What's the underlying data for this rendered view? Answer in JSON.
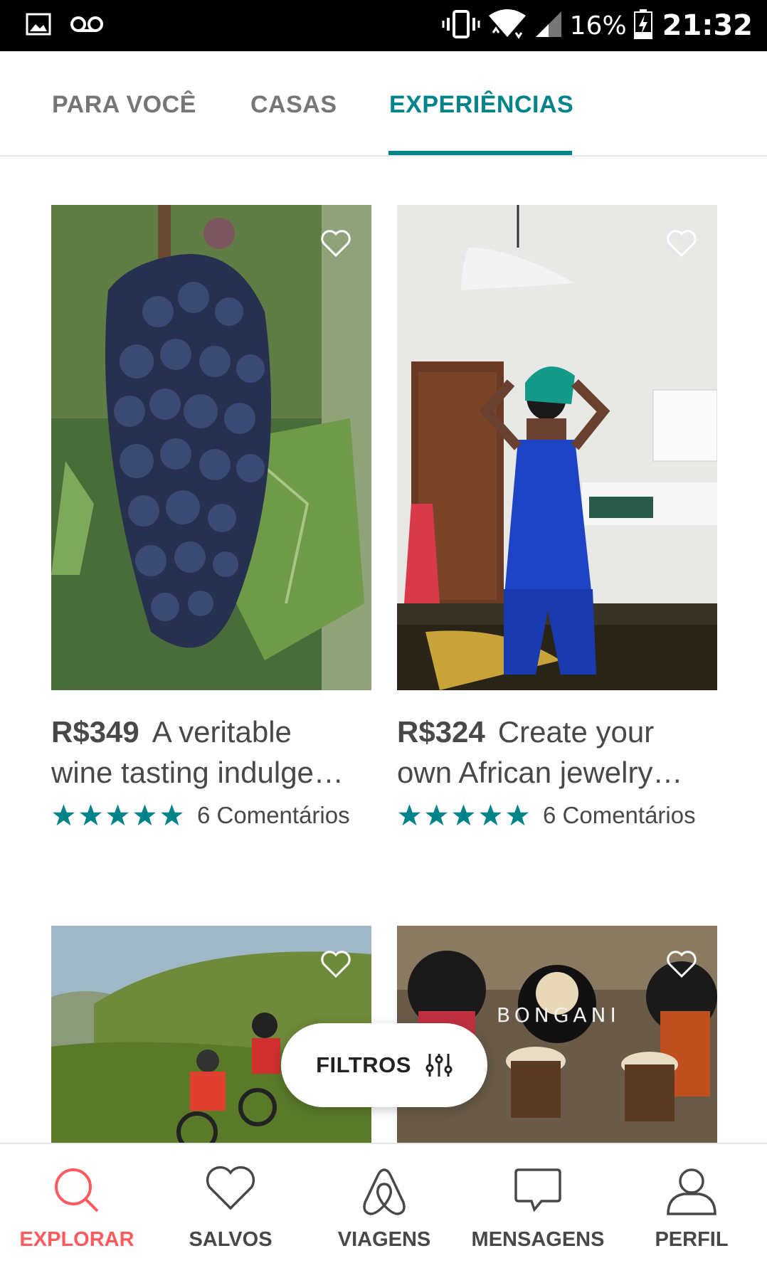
{
  "status_bar": {
    "battery": "16%",
    "time": "21:32"
  },
  "tabs": [
    {
      "label": "PARA VOCÊ",
      "active": false
    },
    {
      "label": "CASAS",
      "active": false
    },
    {
      "label": "EXPERIÊNCIAS",
      "active": true
    }
  ],
  "listings": [
    {
      "price": "R$349",
      "title_line1": "A veritable",
      "title_line2": "wine tasting indulge…",
      "rating_stars": 5,
      "reviews": "6 Comentários",
      "image": "grapes-photo"
    },
    {
      "price": "R$324",
      "title_line1": "Create your",
      "title_line2": "own African jewelry…",
      "rating_stars": 5,
      "reviews": "6 Comentários",
      "image": "jewelry-studio-photo"
    },
    {
      "image": "mountain-biking-photo"
    },
    {
      "image": "drumming-photo",
      "overlay_text": "BONGANI"
    }
  ],
  "filters": {
    "label": "FILTROS"
  },
  "bottom_nav": [
    {
      "label": "EXPLORAR",
      "icon": "search-icon",
      "active": true
    },
    {
      "label": "SALVOS",
      "icon": "heart-icon",
      "active": false
    },
    {
      "label": "VIAGENS",
      "icon": "airbnb-logo-icon",
      "active": false
    },
    {
      "label": "MENSAGENS",
      "icon": "chat-bubble-icon",
      "active": false
    },
    {
      "label": "PERFIL",
      "icon": "person-icon",
      "active": false
    }
  ],
  "colors": {
    "accent_teal": "#008489",
    "brand_red": "#ff5a5f",
    "text": "#484848"
  }
}
